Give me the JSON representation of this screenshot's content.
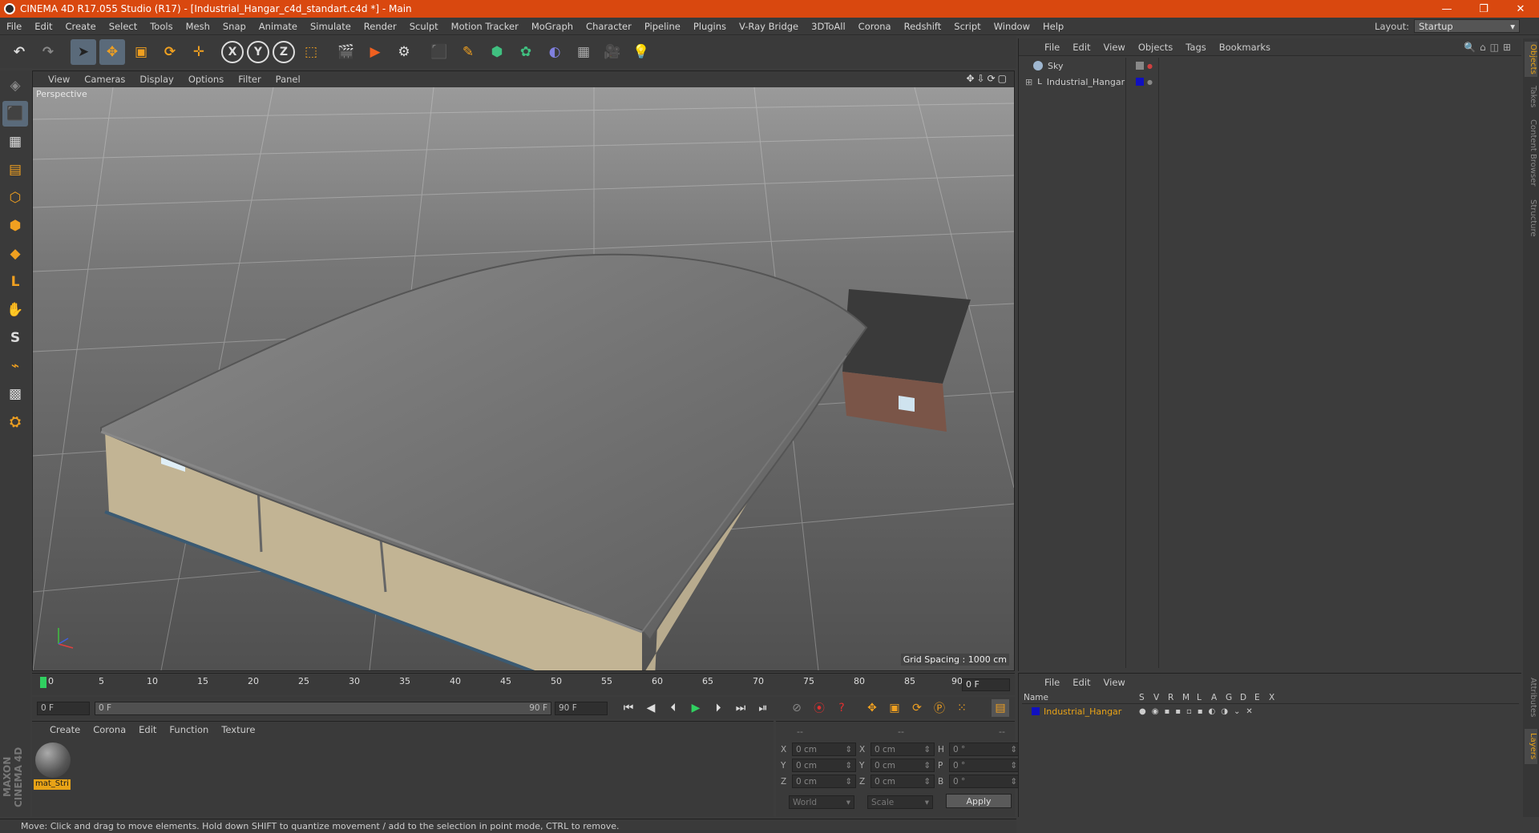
{
  "window": {
    "title": "CINEMA 4D R17.055 Studio (R17) - [Industrial_Hangar_c4d_standart.c4d *] - Main",
    "minimize": "—",
    "restore": "❐",
    "close": "✕"
  },
  "menu": [
    "File",
    "Edit",
    "Create",
    "Select",
    "Tools",
    "Mesh",
    "Snap",
    "Animate",
    "Simulate",
    "Render",
    "Sculpt",
    "Motion Tracker",
    "MoGraph",
    "Character",
    "Pipeline",
    "Plugins",
    "V-Ray Bridge",
    "3DToAll",
    "Corona",
    "Redshift",
    "Script",
    "Window",
    "Help"
  ],
  "layout": {
    "label": "Layout:",
    "value": "Startup"
  },
  "toolbar": {
    "undo": "↶",
    "redo": "↷",
    "select": "➤",
    "move": "✥",
    "scale": "▣",
    "rotate": "⟳",
    "live": "✛",
    "x": "X",
    "y": "Y",
    "z": "Z",
    "coord": "⬚",
    "render_view": "🎬",
    "render": "▶",
    "render_settings": "⚙",
    "cube": "⬛",
    "pen": "✎",
    "subdiv": "⬢",
    "array": "✿",
    "deformer": "◐",
    "floor": "▦",
    "camera": "🎥",
    "light": "💡"
  },
  "lefttools": [
    "◈",
    "⬛",
    "▦",
    "▤",
    "⬡",
    "⬢",
    "◆",
    "L",
    "✋",
    "S",
    "⌁",
    "▩",
    "⛭"
  ],
  "viewport": {
    "menu": [
      "View",
      "Cameras",
      "Display",
      "Options",
      "Filter",
      "Panel"
    ],
    "icons": "✥⇩⟳▢",
    "label": "Perspective",
    "grid_spacing": "Grid Spacing : 1000 cm"
  },
  "timeline": {
    "ticks": [
      "0",
      "5",
      "10",
      "15",
      "20",
      "25",
      "30",
      "35",
      "40",
      "45",
      "50",
      "55",
      "60",
      "65",
      "70",
      "75",
      "80",
      "85",
      "90"
    ],
    "current": "0 F"
  },
  "playback": {
    "start": "0 F",
    "range_start": "0 F",
    "range_end": "90 F",
    "end": "90 F",
    "buttons": [
      "⏮",
      "◀",
      "⏴",
      "▶",
      "⏵",
      "⏭",
      "⏯"
    ]
  },
  "materials": {
    "menu": [
      "Create",
      "Corona",
      "Edit",
      "Function",
      "Texture"
    ],
    "items": [
      {
        "name": "mat_Stri"
      }
    ]
  },
  "coords": {
    "headers": [
      "--",
      "--",
      "--"
    ],
    "rows": [
      {
        "a": "X",
        "av": "0 cm",
        "b": "X",
        "bv": "0 cm",
        "c": "H",
        "cv": "0 °"
      },
      {
        "a": "Y",
        "av": "0 cm",
        "b": "Y",
        "bv": "0 cm",
        "c": "P",
        "cv": "0 °"
      },
      {
        "a": "Z",
        "av": "0 cm",
        "b": "Z",
        "bv": "0 cm",
        "c": "B",
        "cv": "0 °"
      }
    ],
    "mode1": "World",
    "mode2": "Scale",
    "apply": "Apply"
  },
  "status": "Move: Click and drag to move elements. Hold down SHIFT to quantize movement / add to the selection in point mode, CTRL to remove.",
  "objects": {
    "menu": [
      "File",
      "Edit",
      "View",
      "Objects",
      "Tags",
      "Bookmarks"
    ],
    "icons": "🔍⌂◫⊞",
    "items": [
      {
        "name": "Sky",
        "color": "#a0a0a0"
      },
      {
        "name": "Industrial_Hangar",
        "color": "#1010c0"
      }
    ]
  },
  "layers": {
    "menu": [
      "File",
      "Edit",
      "View"
    ],
    "header": {
      "name": "Name",
      "cols": [
        "S",
        "V",
        "R",
        "M",
        "L",
        "A",
        "G",
        "D",
        "E",
        "X"
      ]
    },
    "items": [
      {
        "name": "Industrial_Hangar",
        "color": "#1010c0"
      }
    ]
  },
  "sidetabs": [
    "Objects",
    "Takes",
    "Content Browser",
    "Structure",
    "Attributes",
    "Layers"
  ],
  "brand": "MAXON CINEMA 4D"
}
